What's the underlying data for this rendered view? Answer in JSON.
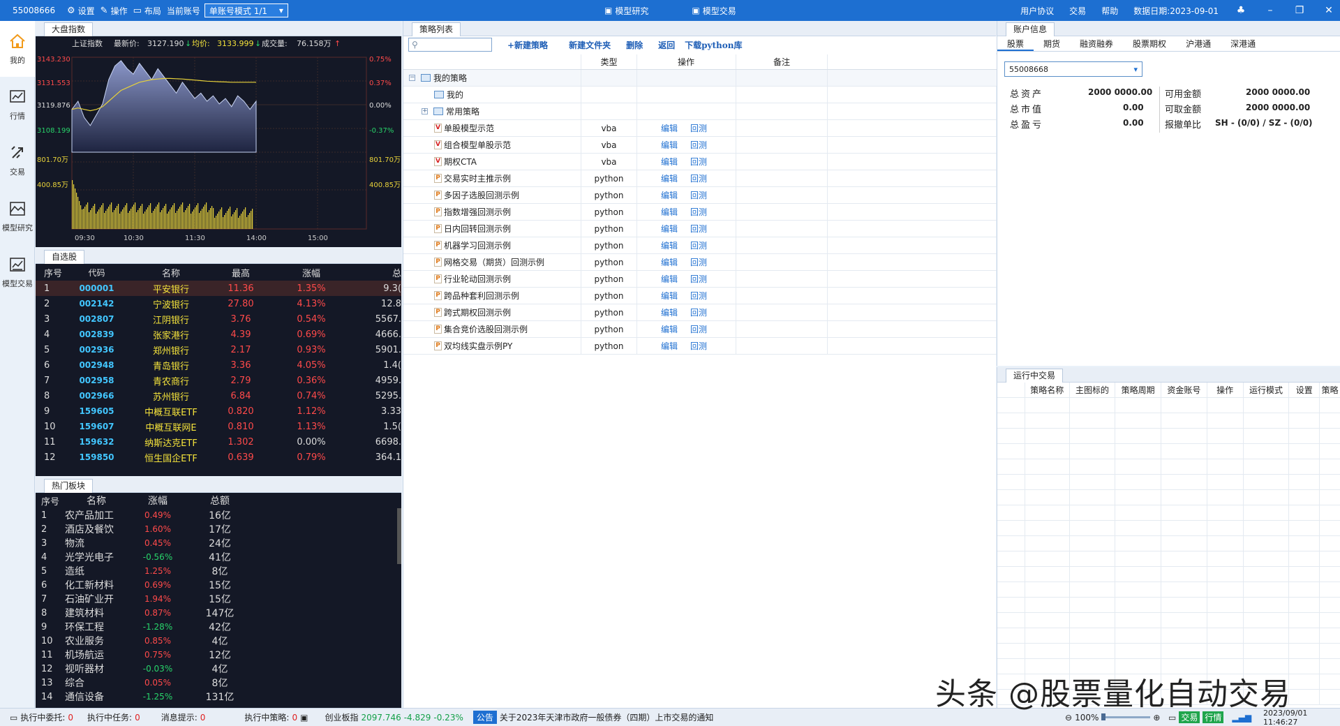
{
  "topbar": {
    "account_id": "55008666",
    "settings": "设置",
    "operate": "操作",
    "layout": "布局",
    "current_account_label": "当前账号",
    "account_mode": "单账号模式 1/1",
    "model_research": "模型研究",
    "model_trade": "模型交易",
    "user_agreement": "用户协议",
    "trade": "交易",
    "help": "帮助",
    "data_date": "数据日期:2023-09-01"
  },
  "nav": {
    "items": [
      {
        "label": "我的",
        "icon": "home-icon"
      },
      {
        "label": "行情",
        "icon": "chart-icon"
      },
      {
        "label": "交易",
        "icon": "exchange-icon"
      },
      {
        "label": "模型研究",
        "icon": "research-icon"
      },
      {
        "label": "模型交易",
        "icon": "model-trade-icon"
      }
    ]
  },
  "index": {
    "tab": "大盘指数",
    "name": "上证指数",
    "last_label": "最新价:",
    "last": "3127.190",
    "avg_label": "均价:",
    "avg": "3133.999",
    "vol_label": "成交量:",
    "vol": "76.158万",
    "left_ticks": [
      "3143.230",
      "3131.553",
      "3119.876",
      "3108.199",
      "801.70万",
      "400.85万"
    ],
    "right_ticks": [
      "0.75%",
      "0.37%",
      "0.00%",
      "-0.37%",
      "801.70万",
      "400.85万"
    ],
    "time_ticks": [
      "09:30",
      "10:30",
      "11:30",
      "14:00",
      "15:00"
    ]
  },
  "watch": {
    "tab": "自选股",
    "headers": [
      "序号",
      "代码",
      "名称",
      "最高",
      "涨幅",
      "总"
    ],
    "rows": [
      {
        "n": "1",
        "code": "000001",
        "name": "平安银行",
        "high": "11.36",
        "chg": "1.35%",
        "tot": "9.3("
      },
      {
        "n": "2",
        "code": "002142",
        "name": "宁波银行",
        "high": "27.80",
        "chg": "4.13%",
        "tot": "12.8"
      },
      {
        "n": "3",
        "code": "002807",
        "name": "江阴银行",
        "high": "3.76",
        "chg": "0.54%",
        "tot": "5567."
      },
      {
        "n": "4",
        "code": "002839",
        "name": "张家港行",
        "high": "4.39",
        "chg": "0.69%",
        "tot": "4666."
      },
      {
        "n": "5",
        "code": "002936",
        "name": "郑州银行",
        "high": "2.17",
        "chg": "0.93%",
        "tot": "5901."
      },
      {
        "n": "6",
        "code": "002948",
        "name": "青岛银行",
        "high": "3.36",
        "chg": "4.05%",
        "tot": "1.4("
      },
      {
        "n": "7",
        "code": "002958",
        "name": "青农商行",
        "high": "2.79",
        "chg": "0.36%",
        "tot": "4959."
      },
      {
        "n": "8",
        "code": "002966",
        "name": "苏州银行",
        "high": "6.84",
        "chg": "0.74%",
        "tot": "5295."
      },
      {
        "n": "9",
        "code": "159605",
        "name": "中概互联ETF",
        "high": "0.820",
        "chg": "1.12%",
        "tot": "3.33"
      },
      {
        "n": "10",
        "code": "159607",
        "name": "中概互联网E",
        "high": "0.810",
        "chg": "1.13%",
        "tot": "1.5("
      },
      {
        "n": "11",
        "code": "159632",
        "name": "纳斯达克ETF",
        "high": "1.302",
        "chg": "0.00%",
        "tot": "6698."
      },
      {
        "n": "12",
        "code": "159850",
        "name": "恒生国企ETF",
        "high": "0.639",
        "chg": "0.79%",
        "tot": "364.1"
      }
    ]
  },
  "hot": {
    "tab": "热门板块",
    "headers": [
      "序号",
      "名称",
      "涨幅",
      "总额"
    ],
    "rows": [
      {
        "n": "1",
        "name": "农产品加工",
        "chg": "0.49%",
        "amt": "16亿",
        "dir": "up"
      },
      {
        "n": "2",
        "name": "酒店及餐饮",
        "chg": "1.60%",
        "amt": "17亿",
        "dir": "up"
      },
      {
        "n": "3",
        "name": "物流",
        "chg": "0.45%",
        "amt": "24亿",
        "dir": "up"
      },
      {
        "n": "4",
        "name": "光学光电子",
        "chg": "-0.56%",
        "amt": "41亿",
        "dir": "dn"
      },
      {
        "n": "5",
        "name": "造纸",
        "chg": "1.25%",
        "amt": "8亿",
        "dir": "up"
      },
      {
        "n": "6",
        "name": "化工新材料",
        "chg": "0.69%",
        "amt": "15亿",
        "dir": "up"
      },
      {
        "n": "7",
        "name": "石油矿业开",
        "chg": "1.94%",
        "amt": "15亿",
        "dir": "up"
      },
      {
        "n": "8",
        "name": "建筑材料",
        "chg": "0.87%",
        "amt": "147亿",
        "dir": "up"
      },
      {
        "n": "9",
        "name": "环保工程",
        "chg": "-1.28%",
        "amt": "42亿",
        "dir": "dn"
      },
      {
        "n": "10",
        "name": "农业服务",
        "chg": "0.85%",
        "amt": "4亿",
        "dir": "up"
      },
      {
        "n": "11",
        "name": "机场航运",
        "chg": "0.75%",
        "amt": "12亿",
        "dir": "up"
      },
      {
        "n": "12",
        "name": "视听器材",
        "chg": "-0.03%",
        "amt": "4亿",
        "dir": "dn"
      },
      {
        "n": "13",
        "name": "综合",
        "chg": "0.05%",
        "amt": "8亿",
        "dir": "up"
      },
      {
        "n": "14",
        "name": "通信设备",
        "chg": "-1.25%",
        "amt": "131亿",
        "dir": "dn"
      }
    ]
  },
  "strategy": {
    "tab": "策略列表",
    "search_placeholder": "",
    "buttons": [
      "+新建策略",
      "新建文件夹",
      "删除",
      "返回",
      "下载python库"
    ],
    "headers": [
      "类型",
      "操作",
      "备注"
    ],
    "root": "我的策略",
    "folders": [
      "我的",
      "常用策略"
    ],
    "edit": "编辑",
    "backtest": "回测",
    "items": [
      {
        "name": "单股模型示范",
        "type": "vba",
        "kind": "V"
      },
      {
        "name": "组合模型单股示范",
        "type": "vba",
        "kind": "V"
      },
      {
        "name": "期权CTA",
        "type": "vba",
        "kind": "V"
      },
      {
        "name": "交易实时主推示例",
        "type": "python",
        "kind": "P"
      },
      {
        "name": "多因子选股回测示例",
        "type": "python",
        "kind": "P"
      },
      {
        "name": "指数增强回测示例",
        "type": "python",
        "kind": "P"
      },
      {
        "name": "日内回转回测示例",
        "type": "python",
        "kind": "P"
      },
      {
        "name": "机器学习回测示例",
        "type": "python",
        "kind": "P"
      },
      {
        "name": "网格交易（期货）回测示例",
        "type": "python",
        "kind": "P"
      },
      {
        "name": "行业轮动回测示例",
        "type": "python",
        "kind": "P"
      },
      {
        "name": "跨品种套利回测示例",
        "type": "python",
        "kind": "P"
      },
      {
        "name": "跨式期权回测示例",
        "type": "python",
        "kind": "P"
      },
      {
        "name": "集合竞价选股回测示例",
        "type": "python",
        "kind": "P"
      },
      {
        "name": "双均线实盘示例PY",
        "type": "python",
        "kind": "P"
      }
    ]
  },
  "account": {
    "tab": "账户信息",
    "tabs": [
      "股票",
      "期货",
      "融资融券",
      "股票期权",
      "沪港通",
      "深港通"
    ],
    "selected": "55008668",
    "total_assets_label": "总资产",
    "total_assets": "2000 0000.00",
    "market_value_label": "总市值",
    "market_value": "0.00",
    "pnl_label": "总盈亏",
    "pnl": "0.00",
    "available_label": "可用金额",
    "available": "2000 0000.00",
    "withdrawable_label": "可取金额",
    "withdrawable": "2000 0000.00",
    "cancel_ratio_label": "报撤单比",
    "cancel_ratio": "SH - (0/0) / SZ - (0/0)"
  },
  "running": {
    "tab": "运行中交易",
    "headers": [
      "策略名称",
      "主图标的",
      "策略周期",
      "资金账号",
      "操作",
      "运行模式",
      "设置",
      "策略"
    ]
  },
  "status": {
    "exec_entrust_label": "执行中委托:",
    "exec_entrust": "0",
    "exec_task_label": "执行中任务:",
    "exec_task": "0",
    "msg_label": "消息提示:",
    "msg": "0",
    "exec_strategy_label": "执行中策略:",
    "exec_strategy": "0",
    "index_name": "创业板指",
    "index_value": "2097.746",
    "index_change": "-4.829",
    "index_pct": "-0.23%",
    "notice_tag": "公告",
    "notice": "关于2023年天津市政府一般债券（四期）上市交易的通知",
    "zoom": "100%",
    "trade_btn": "交易",
    "quote_btn": "行情",
    "datetime": "2023/09/01 11:46:27"
  },
  "watermark": "头条 @股票量化自动交易",
  "chart_data": {
    "type": "line",
    "x_range": [
      "09:30",
      "15:00"
    ],
    "ylim": [
      3108.199,
      3143.23
    ],
    "series": [
      {
        "name": "最新价",
        "values": [
          3124,
          3127,
          3121,
          3118,
          3122,
          3126,
          3135,
          3140,
          3142,
          3139,
          3137,
          3141,
          3138,
          3135,
          3139,
          3136,
          3133,
          3130,
          3134,
          3131,
          3128,
          3130,
          3127,
          3129,
          3126,
          3128,
          3125,
          3129,
          3127,
          3124,
          3127
        ]
      },
      {
        "name": "均价",
        "values": [
          3124,
          3124.5,
          3124,
          3123.5,
          3124,
          3125,
          3127,
          3129,
          3131,
          3132,
          3133,
          3134,
          3134.5,
          3135,
          3135.2,
          3135.4,
          3135.4,
          3135.3,
          3135.2,
          3135,
          3134.8,
          3134.6,
          3134.4,
          3134.3,
          3134.2,
          3134.1,
          3134,
          3134,
          3134,
          3134,
          3134
        ]
      }
    ]
  }
}
